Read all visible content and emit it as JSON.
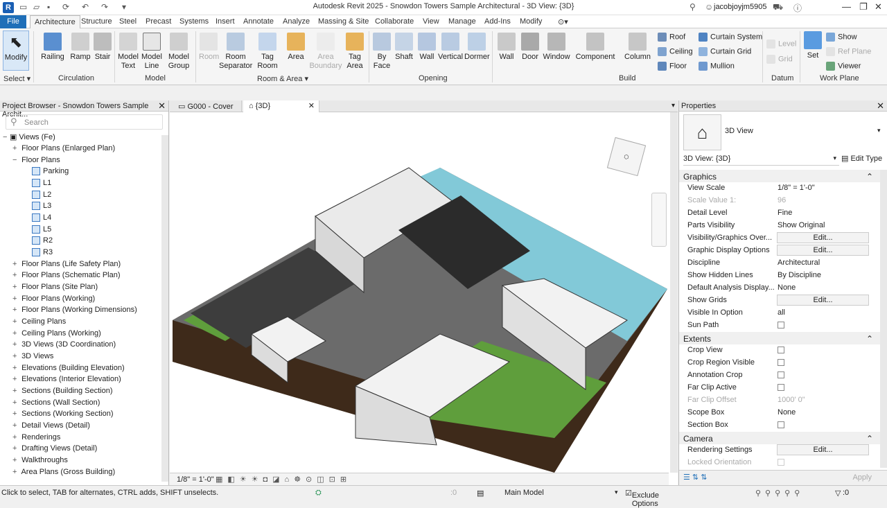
{
  "app": {
    "title": "Autodesk Revit 2025 - Snowdon Towers Sample Architectural - 3D View: {3D}",
    "user": "jacobjoyjm5905"
  },
  "tabs": [
    "File",
    "Architecture",
    "Structure",
    "Steel",
    "Precast",
    "Systems",
    "Insert",
    "Annotate",
    "Analyze",
    "Massing & Site",
    "Collaborate",
    "View",
    "Manage",
    "Add-Ins",
    "Modify"
  ],
  "ribbon": {
    "select": {
      "modify": "Modify",
      "select": "Select"
    },
    "circulation": {
      "railing": "Railing",
      "ramp": "Ramp",
      "stair": "Stair",
      "label": "Circulation"
    },
    "model": {
      "model_text": "Model\nText",
      "model_line": "Model\nLine",
      "model_group": "Model\nGroup",
      "label": "Model"
    },
    "room": {
      "room": "Room",
      "room_sep": "Room\nSeparator",
      "tag_room": "Tag\nRoom",
      "area": "Area",
      "area_boundary": "Area\nBoundary",
      "tag_area": "Tag\nArea",
      "label": "Room & Area"
    },
    "opening": {
      "by_face": "By\nFace",
      "shaft": "Shaft",
      "wall": "Wall",
      "vertical": "Vertical",
      "dormer": "Dormer",
      "label": "Opening"
    },
    "build": {
      "wall": "Wall",
      "door": "Door",
      "window": "Window",
      "component": "Component",
      "column": "Column",
      "roof": "Roof",
      "ceiling": "Ceiling",
      "floor": "Floor",
      "curtain_system": "Curtain  System",
      "curtain_grid": "Curtain  Grid",
      "mullion": "Mullion",
      "label": "Build"
    },
    "datum": {
      "level": "Level",
      "grid": "Grid",
      "label": "Datum"
    },
    "workplane": {
      "set": "Set",
      "show": "Show",
      "ref_plane": "Ref  Plane",
      "viewer": "Viewer",
      "label": "Work Plane"
    }
  },
  "project_browser": {
    "title": "Project Browser - Snowdon Towers Sample Archit...",
    "search_placeholder": "Search",
    "root": "Views (Fe)",
    "items": [
      "Floor Plans (Enlarged Plan)",
      "Floor Plans",
      "Parking",
      "L1",
      "L2",
      "L3",
      "L4",
      "L5",
      "R2",
      "R3",
      "Floor Plans (Life Safety Plan)",
      "Floor Plans (Schematic Plan)",
      "Floor Plans (Site Plan)",
      "Floor Plans (Working)",
      "Floor Plans (Working Dimensions)",
      "Ceiling Plans",
      "Ceiling Plans (Working)",
      "3D Views (3D Coordination)",
      "3D Views",
      "Elevations (Building Elevation)",
      "Elevations (Interior Elevation)",
      "Sections (Building Section)",
      "Sections (Wall Section)",
      "Sections (Working Section)",
      "Detail Views (Detail)",
      "Renderings",
      "Drafting Views (Detail)",
      "Walkthroughs",
      "Area Plans (Gross Building)"
    ]
  },
  "view_tabs": [
    "G000 - Cover",
    "{3D}"
  ],
  "view_scale": "1/8\" = 1'-0\"",
  "properties": {
    "title": "Properties",
    "type": "3D View",
    "selector": "3D View: {3D}",
    "edit_type": "Edit Type",
    "sections": {
      "graphics": "Graphics",
      "extents": "Extents",
      "camera": "Camera"
    },
    "rows": [
      {
        "k": "View Scale",
        "v": "1/8\" = 1'-0\""
      },
      {
        "k": "Scale Value    1:",
        "v": "96"
      },
      {
        "k": "Detail Level",
        "v": "Fine"
      },
      {
        "k": "Parts Visibility",
        "v": "Show Original"
      },
      {
        "k": "Visibility/Graphics Over...",
        "v": "Edit..."
      },
      {
        "k": "Graphic Display Options",
        "v": "Edit..."
      },
      {
        "k": "Discipline",
        "v": "Architectural"
      },
      {
        "k": "Show Hidden Lines",
        "v": "By Discipline"
      },
      {
        "k": "Default Analysis Display...",
        "v": "None"
      },
      {
        "k": "Show Grids",
        "v": "Edit..."
      },
      {
        "k": "Visible In Option",
        "v": "all"
      },
      {
        "k": "Sun Path",
        "v": ""
      },
      {
        "k": "Crop View",
        "v": ""
      },
      {
        "k": "Crop Region Visible",
        "v": ""
      },
      {
        "k": "Annotation Crop",
        "v": ""
      },
      {
        "k": "Far Clip Active",
        "v": ""
      },
      {
        "k": "Far Clip Offset",
        "v": "1000'  0\""
      },
      {
        "k": "Scope Box",
        "v": "None"
      },
      {
        "k": "Section Box",
        "v": ""
      },
      {
        "k": "Rendering Settings",
        "v": "Edit..."
      },
      {
        "k": "Locked Orientation",
        "v": ""
      }
    ],
    "apply": "Apply"
  },
  "status": {
    "hint": "Click to select, TAB for alternates, CTRL adds, SHIFT unselects.",
    "zero1": ":0",
    "model": "Main Model",
    "exclude": "Exclude Options",
    "zero2": ":0"
  }
}
